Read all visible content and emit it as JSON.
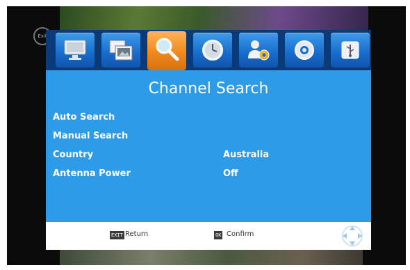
{
  "screen_title": "Channel Search",
  "tabs": [
    {
      "icon": "monitor-icon"
    },
    {
      "icon": "picture-icon"
    },
    {
      "icon": "search-icon",
      "active": true
    },
    {
      "icon": "clock-icon"
    },
    {
      "icon": "user-settings-icon"
    },
    {
      "icon": "gear-icon"
    },
    {
      "icon": "usb-icon"
    }
  ],
  "menu": [
    {
      "label": "Auto Search",
      "value": ""
    },
    {
      "label": "Manual Search",
      "value": ""
    },
    {
      "label": "Country",
      "value": "Australia"
    },
    {
      "label": "Antenna Power",
      "value": "Off"
    }
  ],
  "footer": {
    "exit_key": "EXIT",
    "return_label": "Return",
    "ok_key": "OK",
    "confirm_label": "Confirm"
  },
  "colors": {
    "panel": "#2d9be8",
    "tab": "#1a6fcf",
    "tab_active": "#f08a1e"
  }
}
